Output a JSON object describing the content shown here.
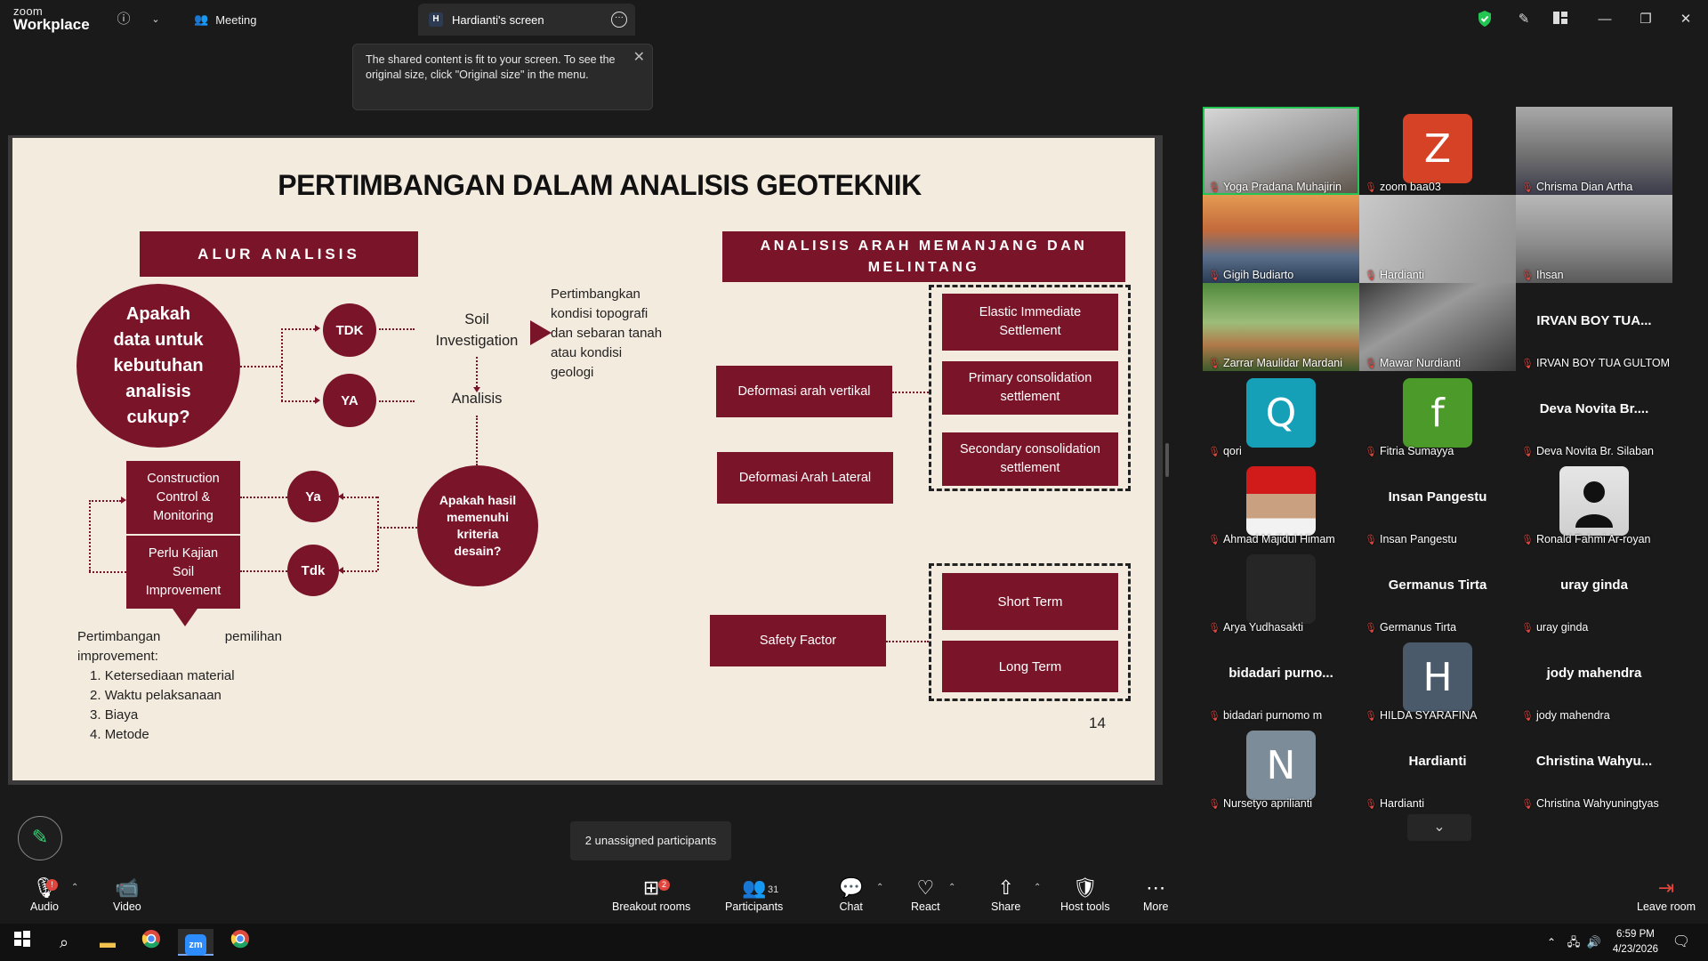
{
  "app": {
    "logo_line1": "zoom",
    "logo_line2": "Workplace"
  },
  "header": {
    "meeting_label": "Meeting",
    "screen_tab_badge": "H",
    "screen_tab_label": "Hardianti's screen",
    "shield_color": "#23c552"
  },
  "tooltip": {
    "text_line1": "The shared content is fit to your screen. To see the",
    "text_line2": "original size, click \"Original size\" in the menu."
  },
  "slide": {
    "title": "PERTIMBANGAN DALAM ANALISIS GEOTEKNIK",
    "left_header": "ALUR ANALISIS",
    "right_header_1": "ANALISIS ARAH MEMANJANG DAN",
    "right_header_2": "MELINTANG",
    "big_question": [
      "Apakah",
      "data untuk",
      "kebutuhan",
      "analisis",
      "cukup?"
    ],
    "tdk_label": "TDK",
    "ya_label": "YA",
    "soil_inv_1": "Soil",
    "soil_inv_2": "Investigation",
    "analisis_label": "Analisis",
    "note_lines": [
      "Pertimbangkan",
      "kondisi topografi",
      "dan sebaran tanah",
      "atau kondisi",
      "geologi"
    ],
    "second_question": [
      "Apakah hasil",
      "memenuhi",
      "kriteria",
      "desain?"
    ],
    "ya2_label": "Ya",
    "tdk2_label": "Tdk",
    "construction_box": [
      "Construction",
      "Control &",
      "Monitoring"
    ],
    "kajian_box": [
      "Perlu Kajian",
      "Soil",
      "Improvement"
    ],
    "improvement_intro_1": "Pertimbangan",
    "improvement_intro_2": "pemilihan",
    "improvement_intro_3": "improvement:",
    "improvement_items": [
      "Ketersediaan material",
      "Waktu pelaksanaan",
      "Biaya",
      "Metode"
    ],
    "vertikal_box": "Deformasi arah vertikal",
    "lateral_box": "Deformasi Arah Lateral",
    "safety_box": "Safety Factor",
    "settlement_1": [
      "Elastic Immediate",
      "Settlement"
    ],
    "settlement_2": [
      "Primary consolidation",
      "settlement"
    ],
    "settlement_3": [
      "Secondary consolidation",
      "settlement"
    ],
    "short_term": "Short Term",
    "long_term": "Long Term",
    "page_number": "14"
  },
  "gallery": [
    {
      "name": "Yoga Pradana Muhajirin",
      "kind": "video",
      "active": true
    },
    {
      "name": "zoom baa03",
      "kind": "avatar",
      "letter": "Z",
      "color": "#d64226"
    },
    {
      "name": "Chrisma Dian Artha",
      "kind": "video"
    },
    {
      "name": "Gigih Budiarto",
      "kind": "video"
    },
    {
      "name": "Hardianti",
      "kind": "video"
    },
    {
      "name": "Ihsan",
      "kind": "video"
    },
    {
      "name": "Zarrar Maulidar Mardani",
      "kind": "video"
    },
    {
      "name": "Mawar Nurdianti",
      "kind": "video"
    },
    {
      "name": "IRVAN BOY TUA GULTOM",
      "kind": "name",
      "display": "IRVAN BOY TUA..."
    },
    {
      "name": "qori",
      "kind": "avatar",
      "letter": "Q",
      "color": "#16a0b8"
    },
    {
      "name": "Fitria Sumayya",
      "kind": "avatar",
      "letter": "f",
      "color": "#4c9a2a"
    },
    {
      "name": "Deva Novita Br. Silaban",
      "kind": "name",
      "display": "Deva Novita Br...."
    },
    {
      "name": "Ahmad Majidul Himam",
      "kind": "photo"
    },
    {
      "name": "Insan Pangestu",
      "kind": "name",
      "display": "Insan Pangestu"
    },
    {
      "name": "Ronald Fahmi Ar-royan",
      "kind": "photo"
    },
    {
      "name": "Arya Yudhasakti",
      "kind": "dark"
    },
    {
      "name": "Germanus Tirta",
      "kind": "name",
      "display": "Germanus Tirta"
    },
    {
      "name": "uray ginda",
      "kind": "name",
      "display": "uray ginda"
    },
    {
      "name": "bidadari purnomo m",
      "kind": "name",
      "display": "bidadari  purno..."
    },
    {
      "name": "HILDA SYARAFINA",
      "kind": "avatar",
      "letter": "H",
      "color": "#4a5a6b"
    },
    {
      "name": "jody mahendra",
      "kind": "name",
      "display": "jody mahendra"
    },
    {
      "name": "Nursetyo aprilianti",
      "kind": "avatar",
      "letter": "N",
      "color": "#7d8c99"
    },
    {
      "name": "Hardianti",
      "kind": "name",
      "display": "Hardianti"
    },
    {
      "name": "Christina Wahyuningtyas",
      "kind": "name",
      "display": "Christina  Wahyu..."
    }
  ],
  "notice": "2 unassigned participants",
  "toolbar": {
    "audio": "Audio",
    "video": "Video",
    "breakout": "Breakout rooms",
    "breakout_badge": "2",
    "participants": "Participants",
    "participants_count": "31",
    "chat": "Chat",
    "react": "React",
    "share": "Share",
    "host_tools": "Host tools",
    "more": "More",
    "leave": "Leave room"
  },
  "taskbar": {
    "time": "6:59 PM",
    "date": "4/23/2026"
  }
}
